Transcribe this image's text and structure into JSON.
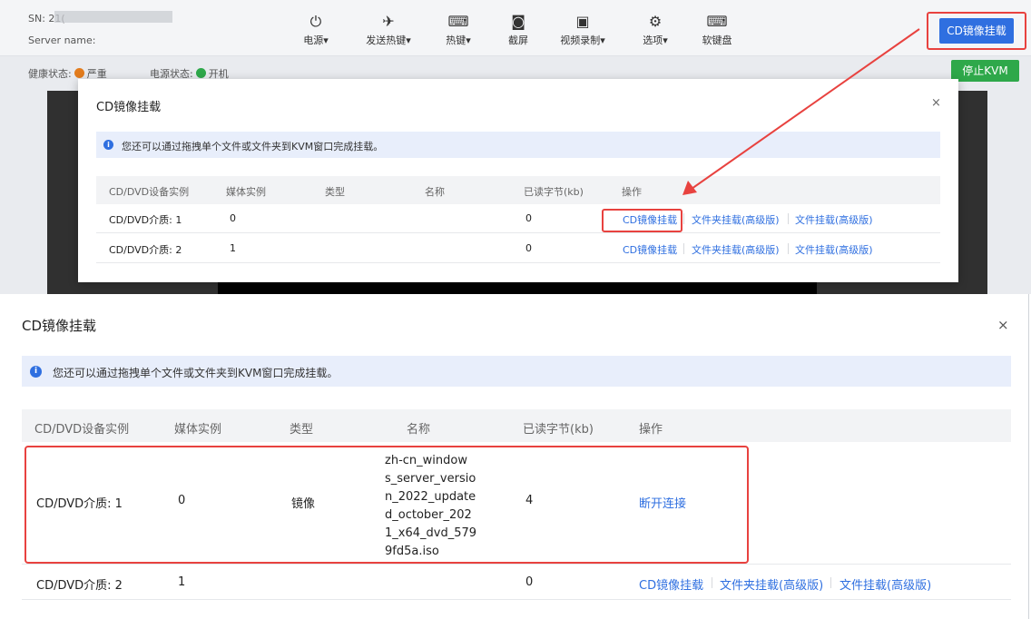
{
  "top_screenshot": {
    "sn_label": "SN: 21(",
    "server_name_label": "Server name:",
    "toolbar": [
      {
        "name": "power",
        "icon": "⏻",
        "label": "电源▾"
      },
      {
        "name": "send-hotkey",
        "icon": "✈",
        "label": "发送热键▾"
      },
      {
        "name": "hotkey",
        "icon": "⌨",
        "label": "热键▾"
      },
      {
        "name": "screenshot",
        "icon": "◙",
        "label": "截屏"
      },
      {
        "name": "video-record",
        "icon": "▣",
        "label": "视频录制▾"
      },
      {
        "name": "options",
        "icon": "⚙",
        "label": "选项▾"
      },
      {
        "name": "soft-keyboard",
        "icon": "⌨",
        "label": "软键盘"
      }
    ],
    "cd_mount_button": "CD镜像挂载",
    "health_label": "健康状态:",
    "health_value": "严重",
    "health_color": "#e37c1d",
    "power_label": "电源状态:",
    "power_value": "开机",
    "power_color": "#2ea84a",
    "stop_kvm_button": "停止KVM",
    "dialog": {
      "title": "CD镜像挂载",
      "close": "×",
      "info_icon": "i",
      "info_text": "您还可以通过拖拽单个文件或文件夹到KVM窗口完成挂载。",
      "columns": [
        "CD/DVD设备实例",
        "媒体实例",
        "类型",
        "名称",
        "已读字节(kb)",
        "操作"
      ],
      "rows": [
        {
          "device": "CD/DVD介质: 1",
          "media": "0",
          "type": "",
          "name": "",
          "read": "0",
          "actions": [
            "CD镜像挂载",
            "文件夹挂载(高级版)",
            "文件挂载(高级版)"
          ]
        },
        {
          "device": "CD/DVD介质: 2",
          "media": "1",
          "type": "",
          "name": "",
          "read": "0",
          "actions": [
            "CD镜像挂载",
            "文件夹挂载(高级版)",
            "文件挂载(高级版)"
          ]
        }
      ]
    }
  },
  "bottom_screenshot": {
    "title": "CD镜像挂载",
    "close": "×",
    "info_icon": "i",
    "info_text": "您还可以通过拖拽单个文件或文件夹到KVM窗口完成挂载。",
    "columns": [
      "CD/DVD设备实例",
      "媒体实例",
      "类型",
      "名称",
      "已读字节(kb)",
      "操作"
    ],
    "rows": [
      {
        "device": "CD/DVD介质: 1",
        "media": "0",
        "type": "镜像",
        "name": "zh-cn_window\ns_server_versio\nn_2022_update\nd_october_202\n1_x64_dvd_579\n9fd5a.iso",
        "read": "4",
        "actions": [
          "断开连接"
        ]
      },
      {
        "device": "CD/DVD介质: 2",
        "media": "1",
        "type": "",
        "name": "",
        "read": "0",
        "actions": [
          "CD镜像挂载",
          "文件夹挂载(高级版)",
          "文件挂载(高级版)"
        ]
      }
    ]
  },
  "colors": {
    "accent": "#2f6fe0",
    "highlight": "#e8423f",
    "info_bg": "#e8eefb"
  }
}
